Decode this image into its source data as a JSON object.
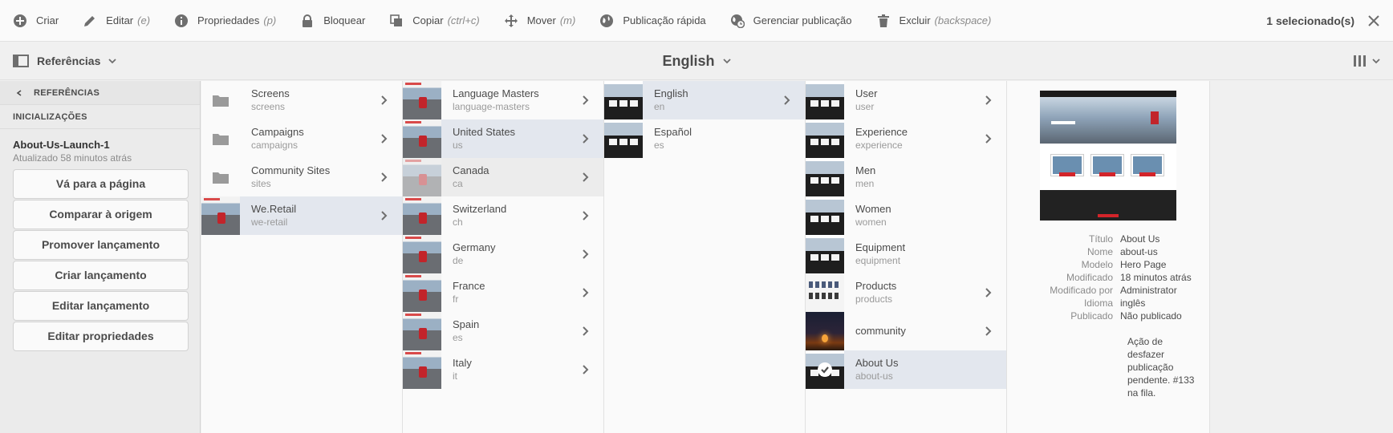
{
  "actionbar": {
    "actions": [
      {
        "label": "Criar",
        "shortcut": "",
        "icon": "add-circle-icon"
      },
      {
        "label": "Editar",
        "shortcut": "(e)",
        "icon": "edit-pencil-icon"
      },
      {
        "label": "Propriedades",
        "shortcut": "(p)",
        "icon": "info-icon"
      },
      {
        "label": "Bloquear",
        "shortcut": "",
        "icon": "lock-icon"
      },
      {
        "label": "Copiar",
        "shortcut": "(ctrl+c)",
        "icon": "copy-icon"
      },
      {
        "label": "Mover",
        "shortcut": "(m)",
        "icon": "move-arrows-icon"
      },
      {
        "label": "Publicação rápida",
        "shortcut": "",
        "icon": "globe-icon"
      },
      {
        "label": "Gerenciar publicação",
        "shortcut": "",
        "icon": "globe-clock-icon"
      },
      {
        "label": "Excluir",
        "shortcut": "(backspace)",
        "icon": "trash-icon"
      }
    ],
    "selection_status": "1 selecionado(s)"
  },
  "toolbar": {
    "rail_label": "Referências",
    "title": "English"
  },
  "rail": {
    "back_label": "REFERÊNCIAS",
    "section_label": "INICIALIZAÇÕES",
    "launch_name": "About-Us-Launch-1",
    "launch_updated": "Atualizado 58 minutos atrás",
    "buttons": [
      "Vá para a página",
      "Comparar à origem",
      "Promover lançamento",
      "Criar lançamento",
      "Editar lançamento",
      "Editar propriedades"
    ]
  },
  "columns": [
    {
      "items": [
        {
          "title": "Screens",
          "name": "screens",
          "thumb": "folder",
          "has_children": true
        },
        {
          "title": "Campaigns",
          "name": "campaigns",
          "thumb": "folder",
          "has_children": true
        },
        {
          "title": "Community Sites",
          "name": "sites",
          "thumb": "folder",
          "has_children": true
        },
        {
          "title": "We.Retail",
          "name": "we-retail",
          "thumb": "hike",
          "has_children": true,
          "selected": true
        }
      ]
    },
    {
      "items": [
        {
          "title": "Language Masters",
          "name": "language-masters",
          "thumb": "hike",
          "has_children": true
        },
        {
          "title": "United States",
          "name": "us",
          "thumb": "hike",
          "has_children": true,
          "selected": true
        },
        {
          "title": "Canada",
          "name": "ca",
          "thumb": "hike-faded",
          "has_children": true,
          "dimmed": true
        },
        {
          "title": "Switzerland",
          "name": "ch",
          "thumb": "hike",
          "has_children": true
        },
        {
          "title": "Germany",
          "name": "de",
          "thumb": "hike",
          "has_children": true
        },
        {
          "title": "France",
          "name": "fr",
          "thumb": "hike",
          "has_children": true
        },
        {
          "title": "Spain",
          "name": "es",
          "thumb": "hike",
          "has_children": true
        },
        {
          "title": "Italy",
          "name": "it",
          "thumb": "hike",
          "has_children": true
        }
      ]
    },
    {
      "items": [
        {
          "title": "English",
          "name": "en",
          "thumb": "page",
          "has_children": true,
          "selected": true
        },
        {
          "title": "Español",
          "name": "es",
          "thumb": "page",
          "has_children": false
        }
      ]
    },
    {
      "items": [
        {
          "title": "User",
          "name": "user",
          "thumb": "page",
          "has_children": true
        },
        {
          "title": "Experience",
          "name": "experience",
          "thumb": "page",
          "has_children": true
        },
        {
          "title": "Men",
          "name": "men",
          "thumb": "page",
          "has_children": false
        },
        {
          "title": "Women",
          "name": "women",
          "thumb": "page",
          "has_children": false
        },
        {
          "title": "Equipment",
          "name": "equipment",
          "thumb": "page",
          "has_children": false
        },
        {
          "title": "Products",
          "name": "products",
          "thumb": "products",
          "has_children": true
        },
        {
          "title": "community",
          "name": "",
          "thumb": "community",
          "has_children": true
        },
        {
          "title": "About Us",
          "name": "about-us",
          "thumb": "page",
          "has_children": false,
          "selected": true,
          "checked": true
        }
      ]
    }
  ],
  "preview": {
    "meta": [
      {
        "key": "Título",
        "value": "About Us"
      },
      {
        "key": "Nome",
        "value": "about-us"
      },
      {
        "key": "Modelo",
        "value": "Hero Page"
      },
      {
        "key": "Modificado",
        "value": "18 minutos atrás"
      },
      {
        "key": "Modificado por",
        "value": "Administrator"
      },
      {
        "key": "Idioma",
        "value": "inglês"
      },
      {
        "key": "Publicado",
        "value": "Não publicado"
      }
    ],
    "note": "Ação de desfazer publicação pendente. #133 na fila."
  }
}
